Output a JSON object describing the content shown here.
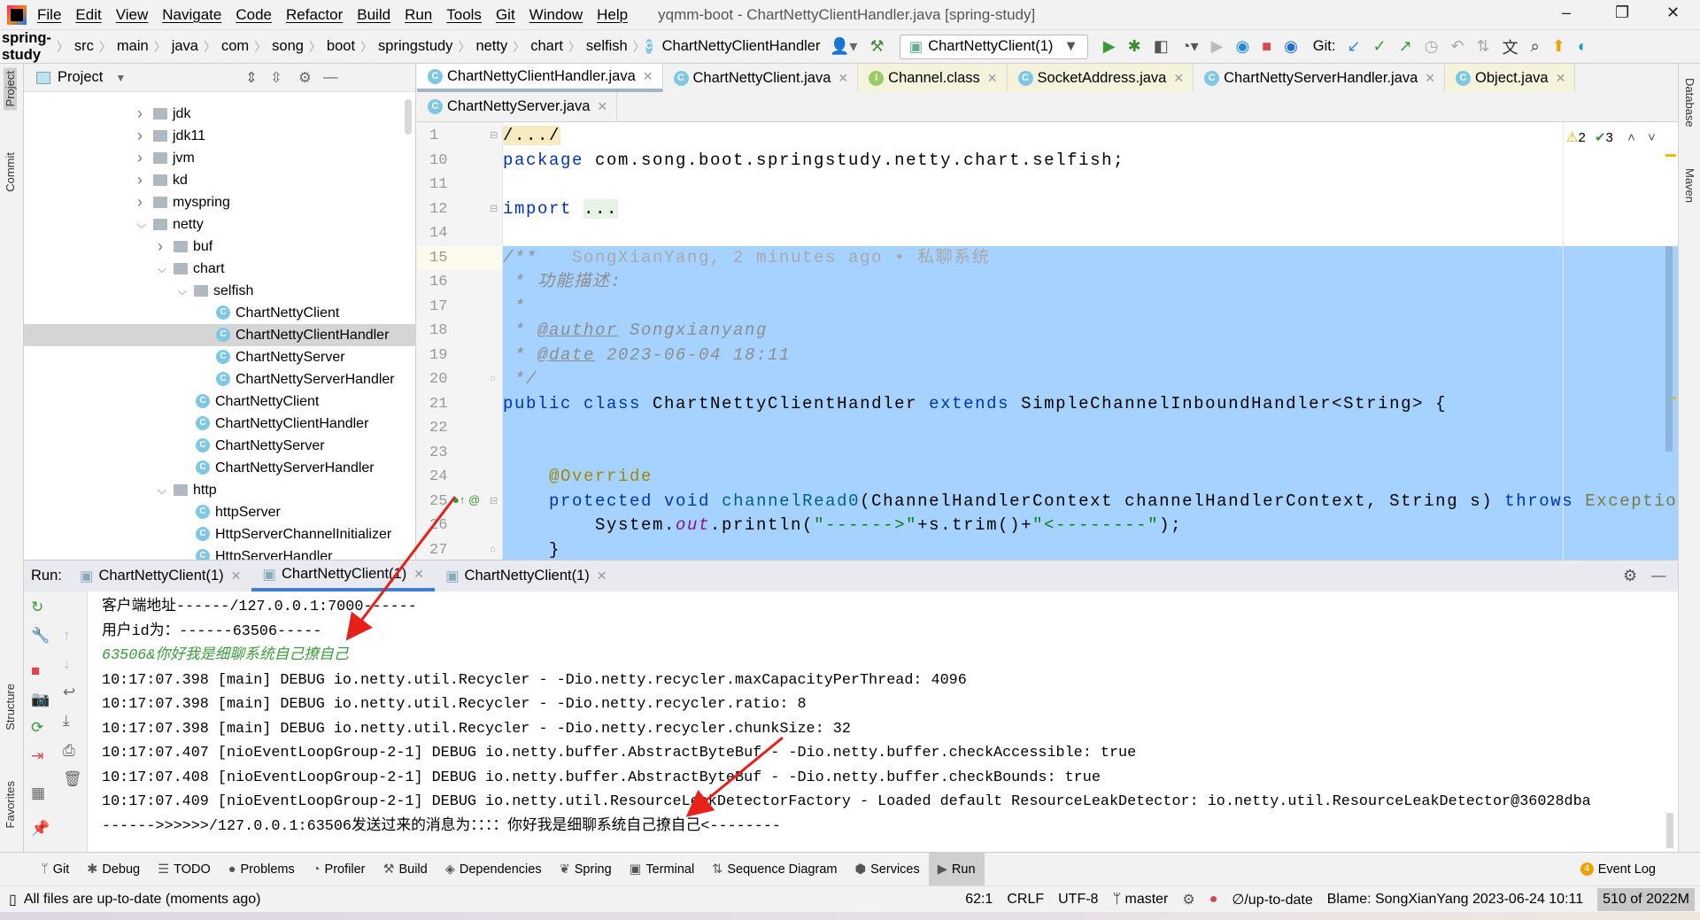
{
  "window": {
    "title": "yqmm-boot - ChartNettyClientHandler.java [spring-study]",
    "minimize": "–",
    "maximize": "❐",
    "close": "✕"
  },
  "menu": [
    "File",
    "Edit",
    "View",
    "Navigate",
    "Code",
    "Refactor",
    "Build",
    "Run",
    "Tools",
    "Git",
    "Window",
    "Help"
  ],
  "breadcrumb": [
    "spring-study",
    "src",
    "main",
    "java",
    "com",
    "song",
    "boot",
    "springstudy",
    "netty",
    "chart",
    "selfish",
    "ChartNettyClientHandler"
  ],
  "toolbar": {
    "run_config": "ChartNettyClient(1)",
    "git_label": "Git:"
  },
  "left_strip": {
    "project": "Project",
    "commit": "Commit",
    "structure": "Structure",
    "favorites": "Favorites"
  },
  "right_strip": {
    "database": "Database",
    "maven": "Maven"
  },
  "project": {
    "title": "Project",
    "tree": [
      {
        "label": "jdk",
        "level": 0,
        "type": "folder",
        "expanded": false
      },
      {
        "label": "jdk11",
        "level": 0,
        "type": "folder",
        "expanded": false
      },
      {
        "label": "jvm",
        "level": 0,
        "type": "folder",
        "expanded": false
      },
      {
        "label": "kd",
        "level": 0,
        "type": "folder",
        "expanded": false
      },
      {
        "label": "myspring",
        "level": 0,
        "type": "folder",
        "expanded": false
      },
      {
        "label": "netty",
        "level": 0,
        "type": "folder",
        "expanded": true
      },
      {
        "label": "buf",
        "level": 1,
        "type": "folder",
        "expanded": false
      },
      {
        "label": "chart",
        "level": 1,
        "type": "folder",
        "expanded": true
      },
      {
        "label": "selfish",
        "level": 2,
        "type": "folder",
        "expanded": true
      },
      {
        "label": "ChartNettyClient",
        "level": 3,
        "type": "class"
      },
      {
        "label": "ChartNettyClientHandler",
        "level": 3,
        "type": "class",
        "selected": true
      },
      {
        "label": "ChartNettyServer",
        "level": 3,
        "type": "class"
      },
      {
        "label": "ChartNettyServerHandler",
        "level": 3,
        "type": "class"
      },
      {
        "label": "ChartNettyClient",
        "level": 2,
        "type": "class"
      },
      {
        "label": "ChartNettyClientHandler",
        "level": 2,
        "type": "class"
      },
      {
        "label": "ChartNettyServer",
        "level": 2,
        "type": "class"
      },
      {
        "label": "ChartNettyServerHandler",
        "level": 2,
        "type": "class"
      },
      {
        "label": "http",
        "level": 1,
        "type": "folder",
        "expanded": true
      },
      {
        "label": "httpServer",
        "level": 2,
        "type": "class"
      },
      {
        "label": "HttpServerChannelInitializer",
        "level": 2,
        "type": "class"
      },
      {
        "label": "HttpServerHandler",
        "level": 2,
        "type": "class"
      }
    ]
  },
  "editor_tabs": [
    [
      {
        "label": "ChartNettyClientHandler.java",
        "icon": "C",
        "active": true
      },
      {
        "label": "ChartNettyClient.java",
        "icon": "C"
      },
      {
        "label": "Channel.class",
        "icon": "I",
        "yellow": true
      },
      {
        "label": "SocketAddress.java",
        "icon": "C",
        "yellow": true
      },
      {
        "label": "ChartNettyServerHandler.java",
        "icon": "C"
      },
      {
        "label": "Object.java",
        "icon": "C",
        "yellow": true
      }
    ],
    [
      {
        "label": "ChartNettyServer.java",
        "icon": "C"
      }
    ]
  ],
  "inspections": {
    "warnings": "2",
    "weak_warnings": "3"
  },
  "code": [
    {
      "n": "1",
      "t": [
        [
          "/.../",
          "fold"
        ]
      ]
    },
    {
      "n": "10",
      "t": [
        [
          "package",
          "k"
        ],
        [
          " com.song.boot.springstudy.netty.chart.selfish;",
          ""
        ]
      ]
    },
    {
      "n": "11",
      "t": []
    },
    {
      "n": "12",
      "t": [
        [
          "import",
          "k"
        ],
        [
          " ",
          ""
        ],
        [
          "...",
          "imp"
        ]
      ]
    },
    {
      "n": "14",
      "t": []
    },
    {
      "n": "15",
      "t": [
        [
          "/**",
          "cm"
        ],
        [
          "   SongXianYang, 2 minutes ago • 私聊系统",
          "hint"
        ]
      ],
      "sel": true,
      "cur": true
    },
    {
      "n": "16",
      "t": [
        [
          " * 功能描述:",
          "cm"
        ]
      ],
      "sel": true
    },
    {
      "n": "17",
      "t": [
        [
          " *",
          "cm"
        ]
      ],
      "sel": true
    },
    {
      "n": "18",
      "t": [
        [
          " * ",
          "cm"
        ],
        [
          "@author",
          "tag"
        ],
        [
          " Songxianyang",
          "cm"
        ]
      ],
      "sel": true
    },
    {
      "n": "19",
      "t": [
        [
          " * ",
          "cm"
        ],
        [
          "@date",
          "tag"
        ],
        [
          " 2023-06-04 18:11",
          "cm"
        ]
      ],
      "sel": true
    },
    {
      "n": "20",
      "t": [
        [
          " */",
          "cm"
        ]
      ],
      "sel": true
    },
    {
      "n": "21",
      "t": [
        [
          "public class",
          "k"
        ],
        [
          " ChartNettyClientHandler ",
          ""
        ],
        [
          "extends",
          "k"
        ],
        [
          " SimpleChannelInboundHandler<String> {",
          ""
        ]
      ],
      "sel": true
    },
    {
      "n": "22",
      "t": [],
      "sel": true
    },
    {
      "n": "23",
      "t": [],
      "sel": true
    },
    {
      "n": "24",
      "t": [
        [
          "    ",
          ""
        ],
        [
          "@Override",
          "an"
        ]
      ],
      "sel": true
    },
    {
      "n": "25",
      "t": [
        [
          "    ",
          ""
        ],
        [
          "protected void",
          "k"
        ],
        [
          " ",
          ""
        ],
        [
          "channelRead0",
          "m"
        ],
        [
          "(ChannelHandlerContext channelHandlerContext, String s) ",
          ""
        ],
        [
          "throws",
          "k"
        ],
        [
          " ",
          ""
        ],
        [
          "Exception",
          "ex"
        ],
        [
          " {",
          ""
        ]
      ],
      "sel": true
    },
    {
      "n": "26",
      "t": [
        [
          "        System.",
          ""
        ],
        [
          "out",
          "f"
        ],
        [
          ".println(",
          ""
        ],
        [
          "\"------>\"",
          "s"
        ],
        [
          "+s.trim()+",
          ""
        ],
        [
          "\"<--------\"",
          "s"
        ],
        [
          ");",
          ""
        ]
      ],
      "sel": true
    },
    {
      "n": "27",
      "t": [
        [
          "    }",
          ""
        ]
      ],
      "sel": true
    }
  ],
  "run": {
    "label": "Run:",
    "tabs": [
      {
        "label": "ChartNettyClient(1)"
      },
      {
        "label": "ChartNettyClient(1)",
        "active": true
      },
      {
        "label": "ChartNettyClient(1)"
      }
    ]
  },
  "console": [
    {
      "text": "客户端地址------/127.0.0.1:7000------"
    },
    {
      "text": "用户id为：------63506-----"
    },
    {
      "text": "63506&你好我是细聊系统自己撩自己",
      "green": true
    },
    {
      "text": "10:17:07.398 [main] DEBUG io.netty.util.Recycler - -Dio.netty.recycler.maxCapacityPerThread: 4096"
    },
    {
      "text": "10:17:07.398 [main] DEBUG io.netty.util.Recycler - -Dio.netty.recycler.ratio: 8"
    },
    {
      "text": "10:17:07.398 [main] DEBUG io.netty.util.Recycler - -Dio.netty.recycler.chunkSize: 32"
    },
    {
      "text": "10:17:07.407 [nioEventLoopGroup-2-1] DEBUG io.netty.buffer.AbstractByteBuf - -Dio.netty.buffer.checkAccessible: true"
    },
    {
      "text": "10:17:07.408 [nioEventLoopGroup-2-1] DEBUG io.netty.buffer.AbstractByteBuf - -Dio.netty.buffer.checkBounds: true"
    },
    {
      "text": "10:17:07.409 [nioEventLoopGroup-2-1] DEBUG io.netty.util.ResourceLeakDetectorFactory - Loaded default ResourceLeakDetector: io.netty.util.ResourceLeakDetector@36028dba"
    },
    {
      "text": "------>>>>>>/127.0.0.1:63506发送过来的消息为：：：：你好我是细聊系统自己撩自己<--------"
    }
  ],
  "tool_windows": [
    {
      "label": "Git",
      "icon": "ᛘ"
    },
    {
      "label": "Debug",
      "icon": "✱"
    },
    {
      "label": "TODO",
      "icon": "☰"
    },
    {
      "label": "Problems",
      "icon": "●"
    },
    {
      "label": "Profiler",
      "icon": "◔"
    },
    {
      "label": "Build",
      "icon": "⚒"
    },
    {
      "label": "Dependencies",
      "icon": "◈"
    },
    {
      "label": "Spring",
      "icon": "❦"
    },
    {
      "label": "Terminal",
      "icon": "▣"
    },
    {
      "label": "Sequence Diagram",
      "icon": "⇅"
    },
    {
      "label": "Services",
      "icon": "⬢"
    },
    {
      "label": "Run",
      "icon": "▶",
      "active": true
    }
  ],
  "event_log": {
    "label": "Event Log",
    "count": "4"
  },
  "status": {
    "message": "All files are up-to-date (moments ago)",
    "position": "62:1",
    "line_sep": "CRLF",
    "encoding": "UTF-8",
    "branch": "master",
    "vcs": "∅/up-to-date",
    "blame": "Blame: SongXianYang 2023-06-24 10:11",
    "memory": "510 of 2022M"
  },
  "colors": {
    "selection": "#a6d2ff",
    "keyword": "#0033b3",
    "string": "#067d17",
    "accent": "#3d7fcc",
    "arrow": "#e8201a"
  }
}
